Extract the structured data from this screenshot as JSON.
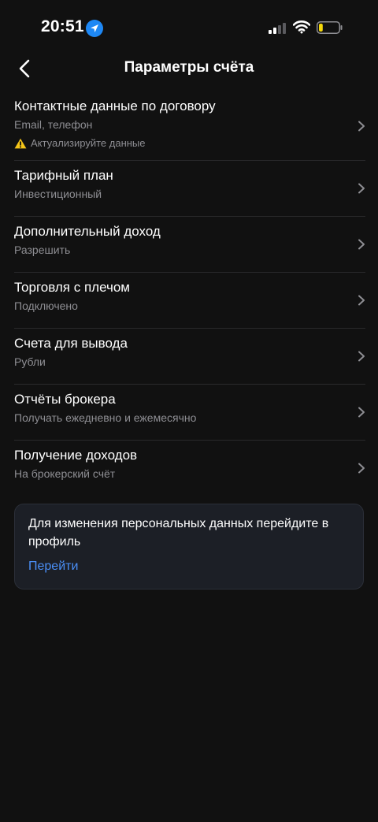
{
  "status_bar": {
    "time": "20:51"
  },
  "header": {
    "title": "Параметры счёта"
  },
  "settings": {
    "items": [
      {
        "title": "Контактные данные по договору",
        "subtitle": "Email, телефон",
        "warning": "Актуализируйте данные"
      },
      {
        "title": "Тарифный план",
        "subtitle": "Инвестиционный"
      },
      {
        "title": "Дополнительный доход",
        "subtitle": "Разрешить"
      },
      {
        "title": "Торговля с плечом",
        "subtitle": "Подключено"
      },
      {
        "title": "Счета для вывода",
        "subtitle": "Рубли"
      },
      {
        "title": "Отчёты брокера",
        "subtitle": "Получать ежедневно и ежемесячно"
      },
      {
        "title": "Получение доходов",
        "subtitle": "На брокерский счёт"
      }
    ]
  },
  "info_card": {
    "text": "Для изменения персональных данных перейдите в профиль",
    "link": "Перейти"
  },
  "colors": {
    "background": "#111111",
    "link": "#4a8ff7",
    "location_badge": "#1e88f5",
    "warning": "#f5c518",
    "battery_level": "#f5d90a"
  },
  "battery_level": 0.2
}
